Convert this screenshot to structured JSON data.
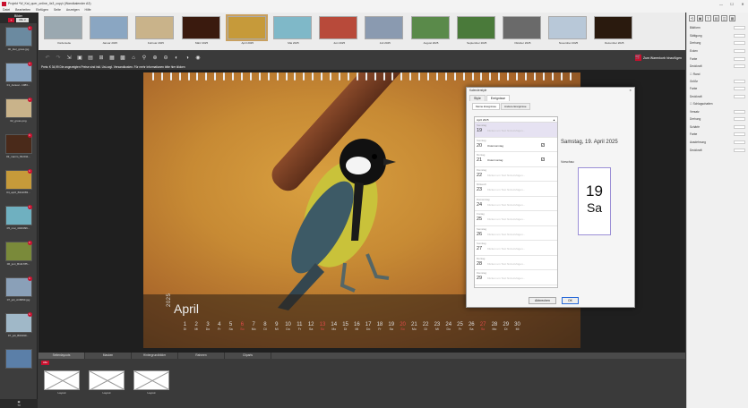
{
  "window": {
    "title": "Projekt *W_Kal_quer_online_4x3_copy\\ (Wandkalender A3)",
    "controls": [
      "—",
      "☐",
      "✕"
    ]
  },
  "menu": [
    "Datei",
    "Bearbeiten",
    "Einfügen",
    "Seite",
    "Anzeigen",
    "Hilfe"
  ],
  "left_panel": {
    "title": "Bilder",
    "add": "+",
    "select": "Alle ∨",
    "photos": [
      {
        "name": "00_titel_gross.jpg",
        "badge": "1",
        "color": "#6b8aa0"
      },
      {
        "name": "01_Januar...1083...",
        "badge": "1",
        "color": "#8aa6c2"
      },
      {
        "name": "02_gross.png",
        "badge": "1",
        "color": "#c9b38a"
      },
      {
        "name": "03_marzo_MU011...",
        "badge": "1",
        "color": "#4a2a1a"
      },
      {
        "name": "04_april_B111083...",
        "badge": "1",
        "color": "#c69a3a"
      },
      {
        "name": "05_mai_4040396...",
        "badge": "1",
        "color": "#6fb0c0"
      },
      {
        "name": "06_juni_B111785...",
        "badge": "1",
        "color": "#7a8a3a"
      },
      {
        "name": "07_juli_A16893.jpg",
        "badge": "1",
        "color": "#8aa0b8"
      },
      {
        "name": "07_juli_B00190...",
        "badge": "1",
        "color": "#a0b8c8"
      },
      {
        "name": "",
        "badge": "",
        "color": "#5b7fa8"
      }
    ],
    "footer_count": "73"
  },
  "months": [
    {
      "name": "Vorderseite",
      "color": "#9aa8b0"
    },
    {
      "name": "Januar 2025",
      "color": "#8aa6c2"
    },
    {
      "name": "Februar 2025",
      "color": "#c9b38a"
    },
    {
      "name": "März 2025",
      "color": "#3a1a0e"
    },
    {
      "name": "April 2025",
      "color": "#c69a3a",
      "active": true
    },
    {
      "name": "Mai 2025",
      "color": "#7fb8c8"
    },
    {
      "name": "Juni 2025",
      "color": "#b84a3a"
    },
    {
      "name": "Juli 2025",
      "color": "#8a9ab0"
    },
    {
      "name": "August 2025",
      "color": "#5a8a4a"
    },
    {
      "name": "September 2025",
      "color": "#4a7a3a"
    },
    {
      "name": "Oktober 2025",
      "color": "#6a6a6a"
    },
    {
      "name": "November 2025",
      "color": "#b8c8d8"
    },
    {
      "name": "Dezember 2025",
      "color": "#2a1a0e"
    }
  ],
  "toolbar": {
    "icons": [
      "↶",
      "↷",
      "⇲",
      "▣",
      "▤",
      "⊞",
      "▦",
      "▩",
      "⌂",
      "⚲",
      "⊕",
      "⊖",
      "◐",
      "◑",
      "◉"
    ],
    "add_cart": "Zum Warenkorb hinzufügen"
  },
  "price": "Preis: € 34,99     Die angezeigten Preise sind inkl. Ust.zzgl. Versandkosten.     Für mehr Informationen bitte hier klicken",
  "calendar": {
    "year": "2025",
    "month": "April",
    "days": [
      {
        "n": "1",
        "w": "Di"
      },
      {
        "n": "2",
        "w": "Mi"
      },
      {
        "n": "3",
        "w": "Do"
      },
      {
        "n": "4",
        "w": "Fr"
      },
      {
        "n": "5",
        "w": "Sa"
      },
      {
        "n": "6",
        "w": "So",
        "sun": true
      },
      {
        "n": "7",
        "w": "Mo"
      },
      {
        "n": "8",
        "w": "Di"
      },
      {
        "n": "9",
        "w": "Mi"
      },
      {
        "n": "10",
        "w": "Do"
      },
      {
        "n": "11",
        "w": "Fr"
      },
      {
        "n": "12",
        "w": "Sa"
      },
      {
        "n": "13",
        "w": "So",
        "sun": true
      },
      {
        "n": "14",
        "w": "Mo"
      },
      {
        "n": "15",
        "w": "Di"
      },
      {
        "n": "16",
        "w": "Mi"
      },
      {
        "n": "17",
        "w": "Do"
      },
      {
        "n": "18",
        "w": "Fr"
      },
      {
        "n": "19",
        "w": "Sa"
      },
      {
        "n": "20",
        "w": "So",
        "sun": true
      },
      {
        "n": "21",
        "w": "Mo"
      },
      {
        "n": "22",
        "w": "Di"
      },
      {
        "n": "23",
        "w": "Mi"
      },
      {
        "n": "24",
        "w": "Do"
      },
      {
        "n": "25",
        "w": "Fr"
      },
      {
        "n": "26",
        "w": "Sa"
      },
      {
        "n": "27",
        "w": "So",
        "sun": true
      },
      {
        "n": "28",
        "w": "Mo"
      },
      {
        "n": "29",
        "w": "Di"
      },
      {
        "n": "30",
        "w": "Mi"
      }
    ]
  },
  "dialog": {
    "title": "Kalenderstyle",
    "close": "✕",
    "tabs": [
      "Style",
      "Ereignisse"
    ],
    "subtabs": [
      "Meine Ereignisse",
      "Andere Ereignisse"
    ],
    "month_header": "April 2025",
    "events": [
      {
        "wd": "Samstag",
        "n": "19",
        "txt": "Klicken um Text hinzuzufügen...",
        "sel": true
      },
      {
        "wd": "Sonntag",
        "n": "20",
        "txt": "Ostersonntag",
        "dark": true,
        "chk": "✓"
      },
      {
        "wd": "Montag",
        "n": "21",
        "txt": "Ostermontag",
        "dark": true,
        "chk": "✓"
      },
      {
        "wd": "Dienstag",
        "n": "22",
        "txt": "Klicken um Text hinzuzufügen..."
      },
      {
        "wd": "Mittwoch",
        "n": "23",
        "txt": "Klicken um Text hinzuzufügen..."
      },
      {
        "wd": "Donnerstag",
        "n": "24",
        "txt": "Klicken um Text hinzuzufügen..."
      },
      {
        "wd": "Freitag",
        "n": "25",
        "txt": "Klicken um Text hinzuzufügen..."
      },
      {
        "wd": "Samstag",
        "n": "26",
        "txt": "Klicken um Text hinzuzufügen..."
      },
      {
        "wd": "Sonntag",
        "n": "27",
        "txt": "Klicken um Text hinzuzufügen..."
      },
      {
        "wd": "Montag",
        "n": "28",
        "txt": "Klicken um Text hinzuzufügen..."
      },
      {
        "wd": "Dienstag",
        "n": "29",
        "txt": "Klicken um Text hinzuzufügen..."
      }
    ],
    "preview_date": "Samstag, 19. April 2025",
    "preview_label": "Vorschau",
    "preview_num": "19",
    "preview_wd": "Sa",
    "cancel": "Abbrechen",
    "ok": "OK"
  },
  "right_panel": {
    "icons": [
      "⟲",
      "▣",
      "T",
      "▤",
      "◫",
      "▦"
    ],
    "props1": [
      "Bildform",
      "Sättigung",
      "Drehung",
      "Ecken",
      "Farbe",
      "Deckkraft"
    ],
    "section_frame": "Rand",
    "props2": [
      "Größe",
      "Farbe",
      "Deckkraft"
    ],
    "section_shadow": "Schlagschatten",
    "props3": [
      "Versatz",
      "Drehung",
      "Schärfe",
      "Farbe",
      "Ausdehnung",
      "Deckkraft"
    ]
  },
  "bottom": {
    "tabs": [
      "Seitenlayouts",
      "Masken",
      "Hintergrundbilder",
      "Rahmen",
      "Cliparts"
    ],
    "all": "Alle",
    "layouts": [
      "Layout",
      "Layout",
      "Layout"
    ]
  }
}
